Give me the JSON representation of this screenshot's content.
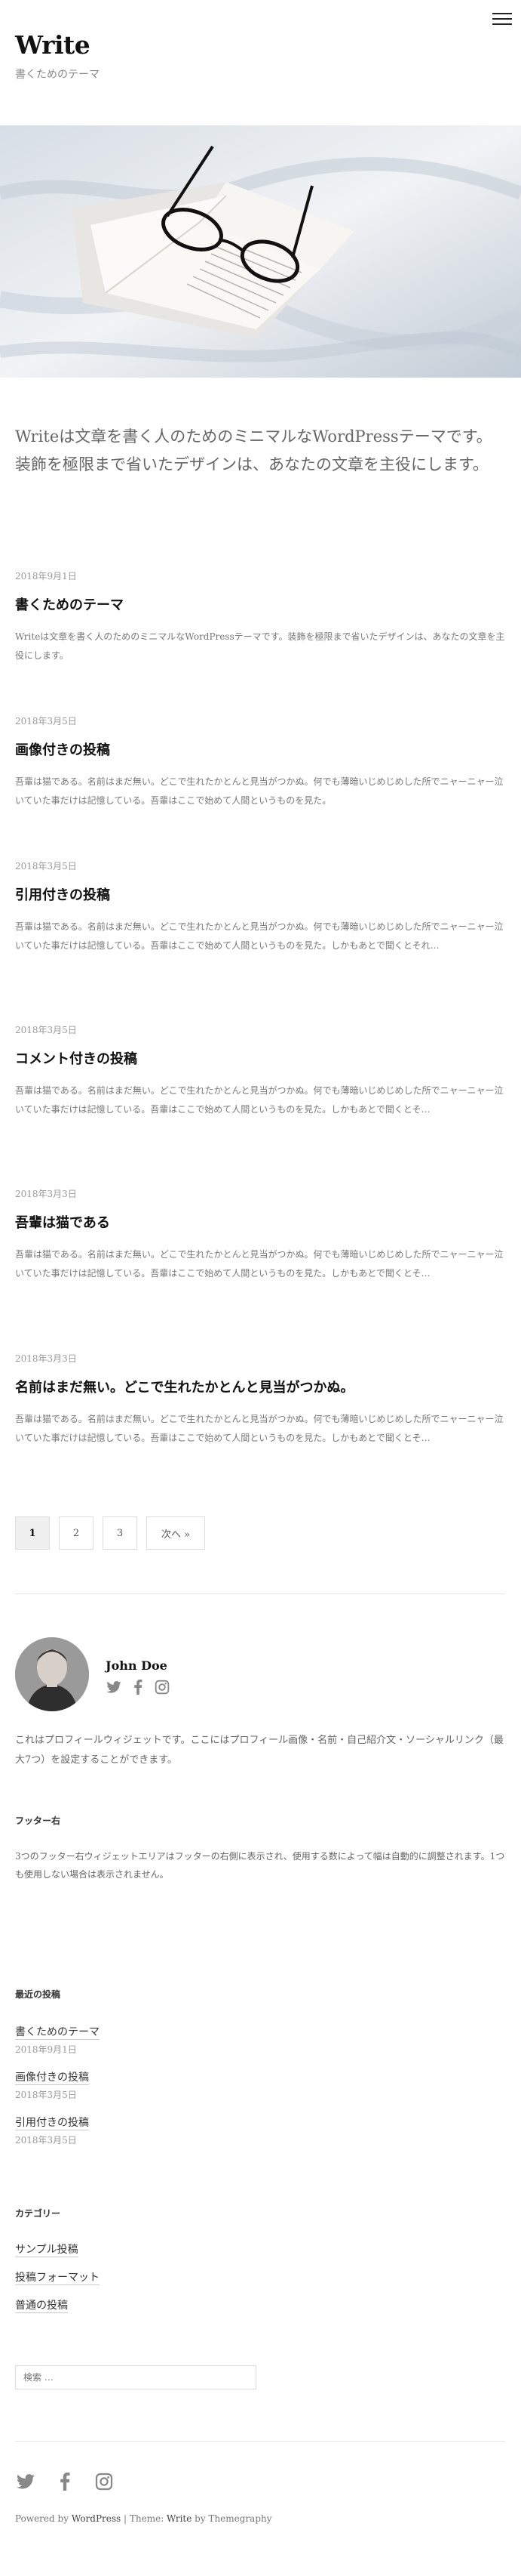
{
  "site": {
    "title": "Write",
    "description": "書くためのテーマ"
  },
  "intro": "Writeは文章を書く人のためのミニマルなWordPressテーマです。装飾を極限まで省いたデザインは、あなたの文章を主役にします。",
  "posts": [
    {
      "date": "2018年9月1日",
      "title": "書くためのテーマ",
      "excerpt": "Writeは文章を書く人のためのミニマルなWordPressテーマです。装飾を極限まで省いたデザインは、あなたの文章を主役にします。"
    },
    {
      "date": "2018年3月5日",
      "title": "画像付きの投稿",
      "excerpt": "吾輩は猫である。名前はまだ無い。どこで生れたかとんと見当がつかぬ。何でも薄暗いじめじめした所でニャーニャー泣いていた事だけは記憶している。吾輩はここで始めて人間というものを見た。"
    },
    {
      "date": "2018年3月5日",
      "title": "引用付きの投稿",
      "excerpt": "吾輩は猫である。名前はまだ無い。どこで生れたかとんと見当がつかぬ。何でも薄暗いじめじめした所でニャーニャー泣いていた事だけは記憶している。吾輩はここで始めて人間というものを見た。しかもあとで聞くとそれ…"
    },
    {
      "date": "2018年3月5日",
      "title": "コメント付きの投稿",
      "excerpt": "吾輩は猫である。名前はまだ無い。どこで生れたかとんと見当がつかぬ。何でも薄暗いじめじめした所でニャーニャー泣いていた事だけは記憶している。吾輩はここで始めて人間というものを見た。しかもあとで聞くとそ…"
    },
    {
      "date": "2018年3月3日",
      "title": "吾輩は猫である",
      "excerpt": "吾輩は猫である。名前はまだ無い。どこで生れたかとんと見当がつかぬ。何でも薄暗いじめじめした所でニャーニャー泣いていた事だけは記憶している。吾輩はここで始めて人間というものを見た。しかもあとで聞くとそ…"
    },
    {
      "date": "2018年3月3日",
      "title": "名前はまだ無い。どこで生れたかとんと見当がつかぬ。",
      "excerpt": "吾輩は猫である。名前はまだ無い。どこで生れたかとんと見当がつかぬ。何でも薄暗いじめじめした所でニャーニャー泣いていた事だけは記憶している。吾輩はここで始めて人間というものを見た。しかもあとで聞くとそ…"
    }
  ],
  "pagination": {
    "pages": [
      "1",
      "2",
      "3"
    ],
    "current": "1",
    "next_label": "次へ »"
  },
  "profile": {
    "name": "John Doe",
    "text": "これはプロフィールウィジェットです。ここにはプロフィール画像・名前・自己紹介文・ソーシャルリンク（最大7つ）を設定することができます。",
    "icons": [
      "twitter-icon",
      "facebook-icon",
      "instagram-icon"
    ]
  },
  "footer_right": {
    "title": "フッター右",
    "text": "3つのフッター右ウィジェットエリアはフッターの右側に表示され、使用する数によって幅は自動的に調整されます。1つも使用しない場合は表示されません。"
  },
  "recent_posts": {
    "title": "最近の投稿",
    "items": [
      {
        "title": "書くためのテーマ",
        "date": "2018年9月1日"
      },
      {
        "title": "画像付きの投稿",
        "date": "2018年3月5日"
      },
      {
        "title": "引用付きの投稿",
        "date": "2018年3月5日"
      }
    ]
  },
  "categories": {
    "title": "カテゴリー",
    "items": [
      "サンプル投稿",
      "投稿フォーマット",
      "普通の投稿"
    ]
  },
  "search": {
    "placeholder": "検索 …"
  },
  "footer": {
    "powered_by": "Powered by",
    "wordpress": "WordPress",
    "separator": " | Theme: ",
    "theme": "Write",
    "by": " by Themegraphy"
  },
  "colors": {
    "text": "#222222",
    "muted": "#888888",
    "border": "#dddddd"
  }
}
